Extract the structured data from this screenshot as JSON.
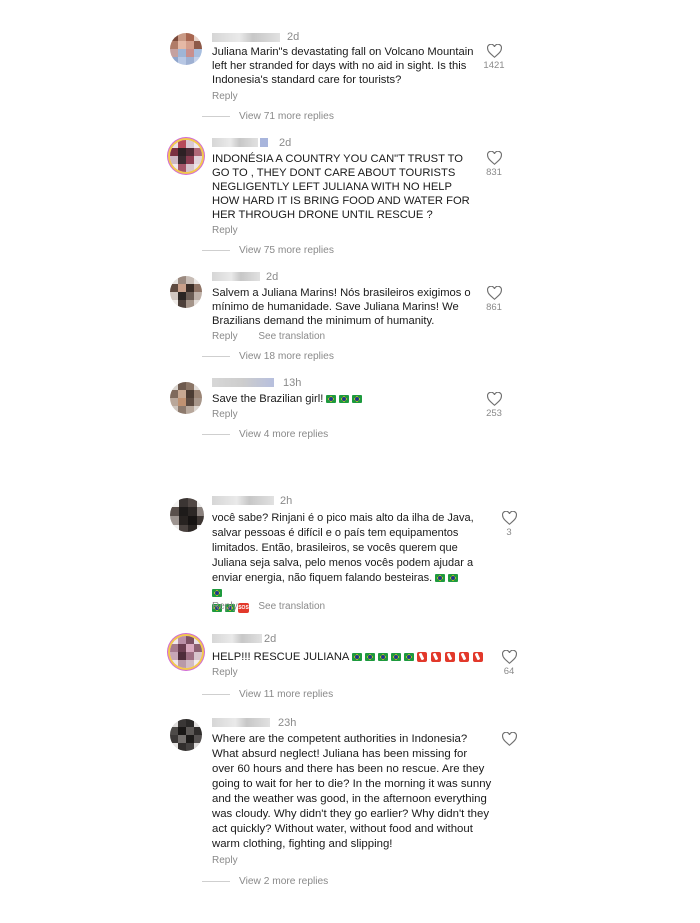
{
  "labels": {
    "reply": "Reply",
    "see_translation": "See translation"
  },
  "comments": [
    {
      "time": "2d",
      "text": "Juliana Marin\"s devastating fall on Volcano Mountain left her stranded for days with no aid in sight. Is this Indonesia's standard care for tourists?",
      "likes": "1421",
      "view_more": "View 71 more replies"
    },
    {
      "time": "2d",
      "text": "INDONÉSIA A COUNTRY YOU CAN\"T TRUST TO GO TO , THEY DONT CARE ABOUT TOURISTS NEGLIGENTLY LEFT JULIANA WITH NO HELP\nHOW HARD IT IS BRING FOOD AND WATER FOR HER THROUGH DRONE UNTIL RESCUE ?",
      "likes": "831",
      "view_more": "View 75 more replies"
    },
    {
      "time": "2d",
      "text": "Salvem a Juliana Marins! Nós brasileiros exigimos o mínimo de humanidade. Save Juliana Marins! We Brazilians demand the minimum of humanity.",
      "likes": "861",
      "view_more": "View 18 more replies"
    },
    {
      "time": "13h",
      "text": "Save the Brazilian girl!",
      "likes": "253",
      "view_more": "View 4 more replies"
    },
    {
      "time": "2h",
      "text": "você sabe? Rinjani é o pico mais alto da ilha de Java, salvar pessoas é difícil e o país tem equipamentos limitados. Então, brasileiros, se vocês querem que Juliana seja salva, pelo menos vocês podem ajudar a enviar energia, não fiquem falando besteiras.",
      "likes": "3"
    },
    {
      "time": "2d",
      "text": "HELP!!! RESCUE JULIANA",
      "likes": "64",
      "view_more": "View 11 more replies"
    },
    {
      "time": "23h",
      "text": "Where are the competent authorities in Indonesia? What absurd neglect! Juliana has been missing for over 60 hours and there has been no rescue. Are they going to wait for her to die? In the morning it was sunny and the weather was good, in the afternoon everything was cloudy. Why didn't they go earlier? Why didn't they act quickly? Without water, without food and without warm clothing, fighting and slipping!",
      "view_more": "View 2 more replies"
    }
  ]
}
